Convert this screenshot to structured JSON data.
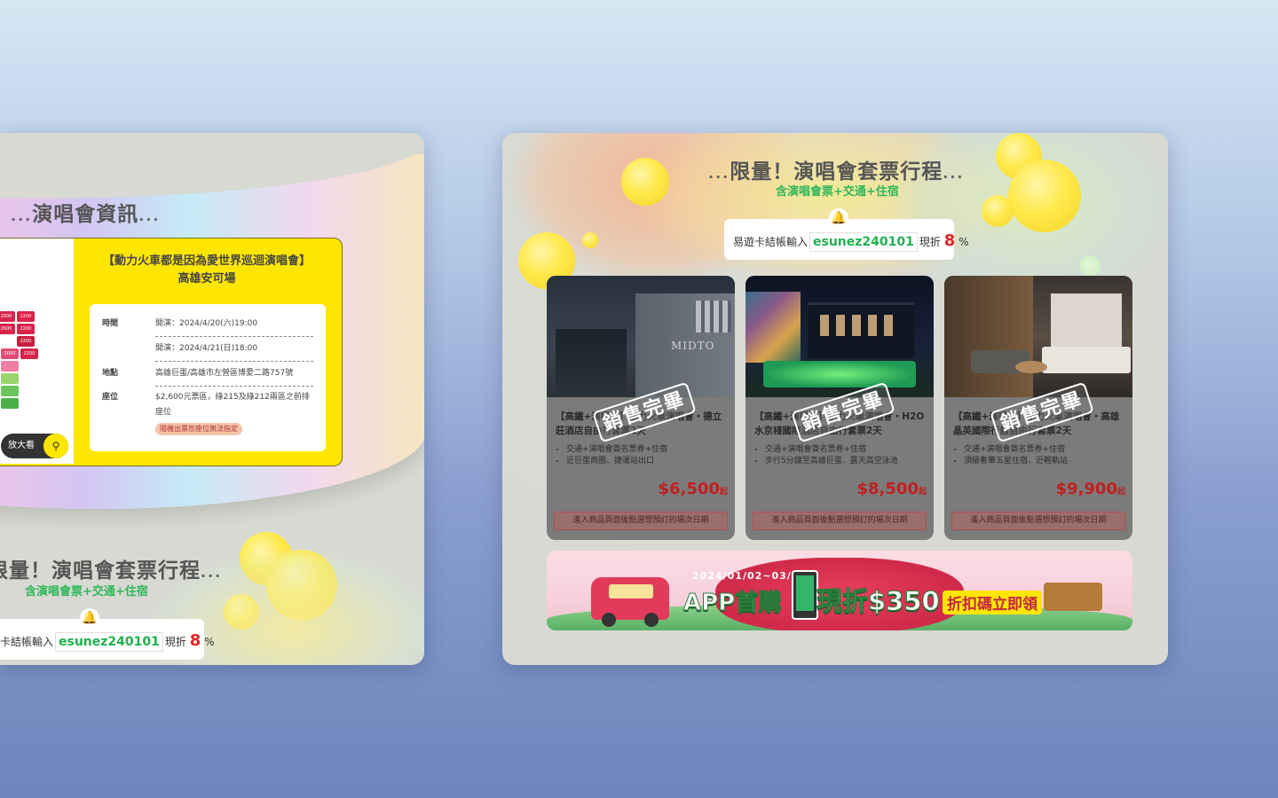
{
  "left_panel": {
    "concert_info_title": "演唱會資訊",
    "title_dots_before": "...",
    "title_dots_after": "...",
    "event_title_line1": "【動力火車都是因為愛世界巡迴演唱會】",
    "event_title_line2": "高雄安可場",
    "zoom_label": "放大看",
    "seat_prices": [
      "2600",
      "2200",
      "2600",
      "2200",
      "2600",
      "2200",
      "2000",
      "2200"
    ],
    "info": {
      "time_label": "時間",
      "time_1": "開演：2024/4/20(六)19:00",
      "time_2": "開演：2024/4/21(日)18:00",
      "place_label": "地點",
      "place": "高雄巨蛋/高雄市左營區博愛二路757號",
      "seat_label": "座位",
      "seat_text": "$2,600元票區，綠215及綠212兩區之前排座位",
      "seat_note": "隨機出票恕座位無法指定"
    },
    "package_title": "限量！演唱會套票行程",
    "package_subtitle": "含演唱會票+交通+住宿",
    "promo_prefix": "卡結帳輸入",
    "promo_code": "esunez240101",
    "promo_mid": "現折",
    "promo_pct": "8",
    "promo_unit": "%"
  },
  "right_panel": {
    "package_title": "限量！演唱會套票行程",
    "title_dots_before": "...",
    "title_dots_after": "...",
    "package_subtitle": "含演唱會票+交通+住宿",
    "promo_prefix": "易遊卡結帳輸入",
    "promo_code": "esunez240101",
    "promo_mid": "現折",
    "promo_pct": "8",
    "promo_unit": "%",
    "sold_out": "銷售完畢",
    "products": [
      {
        "title": "【高鐵+演唱會】動力火車演唱會・德立莊酒店自由行套票2天",
        "bullet_1": "交通+演唱會簽名票券+住宿",
        "bullet_2": "近巨蛋商圈、捷運站出口",
        "price": "$6,500",
        "price_suffix": "起",
        "book": "進入商品頁面後點選想預訂的場次日期"
      },
      {
        "title": "【高鐵+演唱會】動力火車演唱會・H2O水京棧國際酒店自由行套票2天",
        "bullet_1": "交通+演唱會簽名票券+住宿",
        "bullet_2": "步行5分鐘至高雄巨蛋、露天高空泳池",
        "price": "$8,500",
        "price_suffix": "起",
        "book": "進入商品頁面後點選想預訂的場次日期"
      },
      {
        "title": "【高鐵+演唱會】動力火車演唱會・高雄晶英國際行館自由行套票2天",
        "bullet_1": "交通+演唱會簽名票券+住宿",
        "bullet_2": "頂級奢華五星住宿、近輕軌站",
        "price": "$9,900",
        "price_suffix": "起",
        "book": "進入商品頁面後點選想預訂的場次日期"
      }
    ],
    "banner": {
      "date": "2024/01/02~03/31",
      "headline": "APP首購",
      "discount": "現折$350",
      "tail": "折扣碼立即領"
    }
  },
  "colors": {
    "accent_yellow": "#ffe600",
    "promo_green": "#20b04f",
    "price_red": "#c21f1f"
  }
}
